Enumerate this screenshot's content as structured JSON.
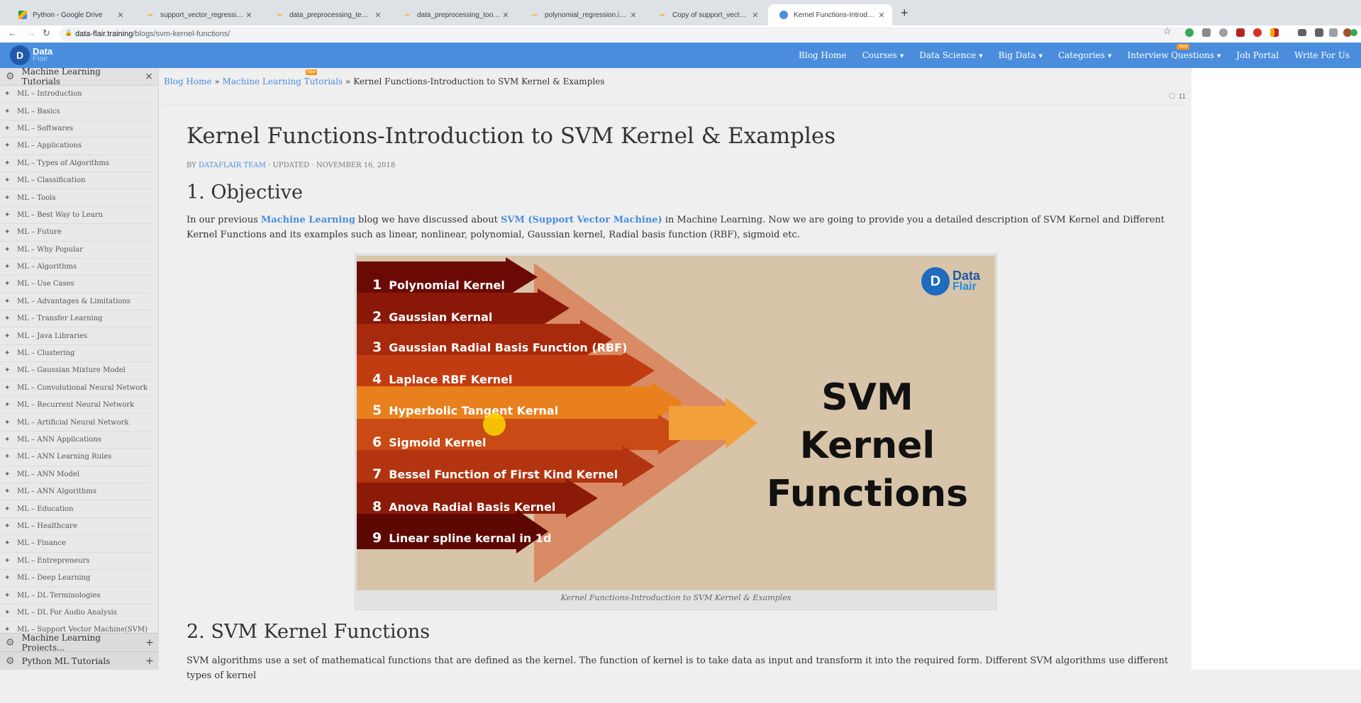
{
  "browser": {
    "tabs": [
      {
        "title": "Python - Google Drive",
        "icon": "google-drive-icon",
        "active": false
      },
      {
        "title": "support_vector_regression.ipynb",
        "icon": "colab-icon",
        "active": false
      },
      {
        "title": "data_preprocessing_template.ipynb",
        "icon": "colab-icon",
        "active": false
      },
      {
        "title": "data_preprocessing_tools.ipynb",
        "icon": "colab-icon",
        "active": false
      },
      {
        "title": "polynomial_regression.ipynb - C",
        "icon": "colab-icon",
        "active": false
      },
      {
        "title": "Copy of support_vector_regression",
        "icon": "colab-icon",
        "active": false
      },
      {
        "title": "Kernel Functions-Introduction to",
        "icon": "dataflair-icon",
        "active": true
      }
    ],
    "url_domain": "data-flair.training",
    "url_path": "/blogs/svm-kernel-functions/"
  },
  "header": {
    "logo_top": "Data",
    "logo_bottom": "Flair",
    "menu": [
      {
        "label": "Blog Home",
        "dropdown": false
      },
      {
        "label": "Courses",
        "dropdown": true
      },
      {
        "label": "Data Science",
        "dropdown": true
      },
      {
        "label": "Big Data",
        "dropdown": true
      },
      {
        "label": "Categories",
        "dropdown": true
      },
      {
        "label": "Interview Questions",
        "dropdown": true,
        "badge": "New"
      },
      {
        "label": "Job Portal",
        "dropdown": false
      },
      {
        "label": "Write For Us",
        "dropdown": false
      }
    ]
  },
  "sidebar": {
    "title": "Machine Learning Tutorials",
    "close": "×",
    "items": [
      "ML – Introduction",
      "ML – Basics",
      "ML – Softwares",
      "ML – Applications",
      "ML – Types of Algorithms",
      "ML – Classification",
      "ML – Tools",
      "ML – Best Way to Learn",
      "ML – Future",
      "ML – Why Popular",
      "ML – Algorithms",
      "ML – Use Cases",
      "ML – Advantages & Limitations",
      "ML – Transfer Learning",
      "ML – Java Libraries",
      "ML – Clustering",
      "ML – Gaussian Mixture Model",
      "ML – Convolutional Neural Network",
      "ML – Recurrent Neural Network",
      "ML – Artificial Neural Network",
      "ML – ANN Applications",
      "ML – ANN Learning Rules",
      "ML – ANN Model",
      "ML – ANN Algorithms",
      "ML – Education",
      "ML – Healthcare",
      "ML – Finance",
      "ML – Entrepreneurs",
      "ML – Deep Learning",
      "ML – DL Terminologies",
      "ML – DL For Audio Analysis",
      "ML – Support Vector Machine(SVM)"
    ],
    "footer_sections": [
      "Machine Learning Projects...",
      "Python ML Tutorials"
    ]
  },
  "breadcrumb": {
    "home": "Blog Home",
    "sep": "»",
    "parent": "Machine Learning Tutorials",
    "parent_badge": "New",
    "current": "Kernel Functions-Introduction to SVM Kernel & Examples"
  },
  "comments_count": "11",
  "article": {
    "title": "Kernel Functions-Introduction to SVM Kernel & Examples",
    "meta_by": "BY",
    "meta_author": "DATAFLAIR TEAM",
    "meta_rest": "· UPDATED · NOVEMBER 16, 2018",
    "section1": "1. Objective",
    "p1_a": "In our previous ",
    "p1_link1": "Machine Learning",
    "p1_b": " blog we have discussed about ",
    "p1_link2": "SVM (Support Vector Machine)",
    "p1_c": " in Machine Learning. Now we are going to provide you a detailed description of SVM Kernel and Different Kernel Functions and its examples such as linear, nonlinear, polynomial, Gaussian kernel, Radial basis function (RBF), sigmoid etc.",
    "section2": "2. SVM Kernel Functions",
    "p2": "SVM algorithms use a set of mathematical functions that are defined as the kernel. The function of kernel is to take data as input and transform it into the required form. Different SVM algorithms use different types of kernel"
  },
  "figure": {
    "kernels": [
      {
        "n": "1",
        "name": "Polynomial Kernel"
      },
      {
        "n": "2",
        "name": "Gaussian Kernal"
      },
      {
        "n": "3",
        "name": "Gaussian Radial Basis Function (RBF)"
      },
      {
        "n": "4",
        "name": "Laplace RBF Kernel"
      },
      {
        "n": "5",
        "name": "Hyperbolic Tangent Kernal"
      },
      {
        "n": "6",
        "name": "Sigmoid Kernel"
      },
      {
        "n": "7",
        "name": "Bessel Function of First Kind Kernel"
      },
      {
        "n": "8",
        "name": "Anova Radial Basis Kernel"
      },
      {
        "n": "9",
        "name": "Linear spline kernal in 1d"
      }
    ],
    "title_line1": "SVM Kernel",
    "title_line2": "Functions",
    "logo_top": "Data",
    "logo_bottom": "Flair",
    "caption": "Kernel Functions-Introduction to SVM Kernel & Examples",
    "band_colors": [
      "#6b0a05",
      "#8a1808",
      "#a82a0c",
      "#c23c12",
      "#e8801e",
      "#c94a14",
      "#b33410",
      "#8c1a08",
      "#5e0804"
    ]
  }
}
